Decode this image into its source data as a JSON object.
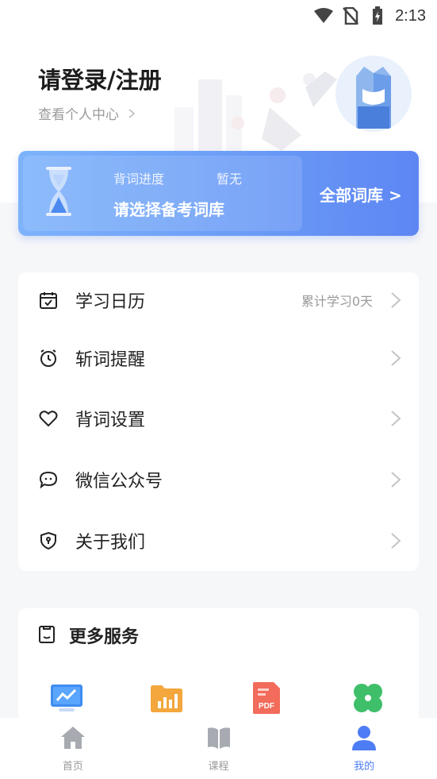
{
  "status_bar": {
    "time": "2:13"
  },
  "header": {
    "login_title": "请登录/注册",
    "profile_link": "查看个人中心"
  },
  "progress_card": {
    "label": "背词进度",
    "value": "暂无",
    "select_prompt": "请选择备考词库",
    "all_libraries": "全部词库 >"
  },
  "menu": {
    "items": [
      {
        "label": "学习日历",
        "extra": "累计学习0天",
        "icon": "calendar-icon"
      },
      {
        "label": "斩词提醒",
        "extra": "",
        "icon": "alarm-clock-icon"
      },
      {
        "label": "背词设置",
        "extra": "",
        "icon": "heart-icon"
      },
      {
        "label": "微信公众号",
        "extra": "",
        "icon": "chat-bubble-icon"
      },
      {
        "label": "关于我们",
        "extra": "",
        "icon": "shield-icon"
      }
    ]
  },
  "services": {
    "title": "更多服务",
    "items": [
      {
        "icon": "monitor-chart-icon"
      },
      {
        "icon": "folder-chart-icon"
      },
      {
        "icon": "pdf-icon",
        "text": "PDF"
      },
      {
        "icon": "clover-icon"
      }
    ]
  },
  "tabbar": {
    "tabs": [
      {
        "label": "首页",
        "icon": "home-icon",
        "active": false
      },
      {
        "label": "课程",
        "icon": "book-icon",
        "active": false
      },
      {
        "label": "我的",
        "icon": "user-icon",
        "active": true
      }
    ]
  },
  "colors": {
    "accent": "#4d7cf4",
    "card_gradient_start": "#7db3fb",
    "card_gradient_end": "#5d86f3"
  }
}
